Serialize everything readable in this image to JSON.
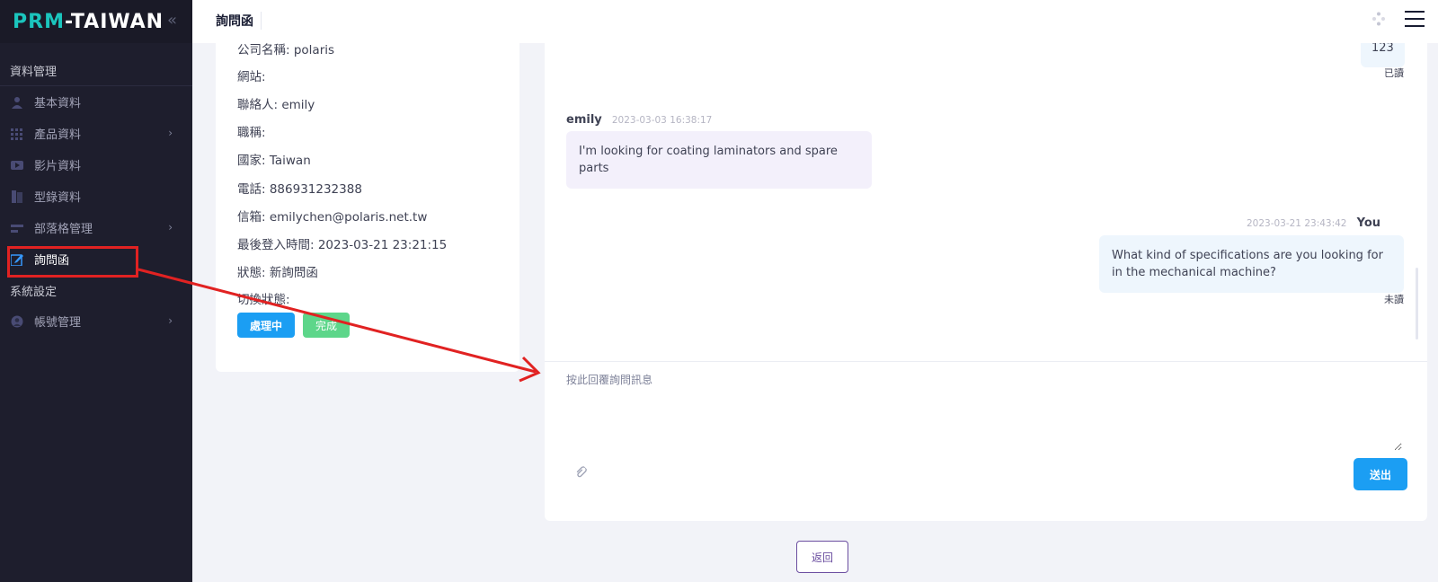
{
  "brand": {
    "logo_part1": "PRM",
    "logo_part2": "-TAIWAN",
    "toggle": "«"
  },
  "sidebar": {
    "section_data": "資料管理",
    "items": [
      {
        "label": "基本資料",
        "icon": "user-icon",
        "has_arrow": false
      },
      {
        "label": "產品資料",
        "icon": "grid-icon",
        "has_arrow": true
      },
      {
        "label": "影片資料",
        "icon": "video-icon",
        "has_arrow": false
      },
      {
        "label": "型錄資料",
        "icon": "book-icon",
        "has_arrow": false
      },
      {
        "label": "部落格管理",
        "icon": "blog-icon",
        "has_arrow": true
      },
      {
        "label": "詢問函",
        "icon": "edit-icon",
        "has_arrow": false,
        "active": true
      }
    ],
    "section_system": "系統設定",
    "system_items": [
      {
        "label": "帳號管理",
        "icon": "account-icon",
        "has_arrow": true
      }
    ],
    "arrow_glyph": "›"
  },
  "header": {
    "title": "詢問函"
  },
  "info": {
    "company": "公司名稱: polaris",
    "website": "網站:",
    "contact": "聯絡人: emily",
    "job_title": "職稱:",
    "country": "國家: Taiwan",
    "phone": "電話: 886931232388",
    "email": "信箱: emilychen@polaris.net.tw",
    "last_login": "最後登入時間: 2023-03-21 23:21:15",
    "status": "狀態: 新詢問函",
    "switch_status": "切換狀態:",
    "btn_processing": "處理中",
    "btn_done": "完成"
  },
  "chat": {
    "first_out_text": "123",
    "first_out_read": "已讀",
    "msg1": {
      "name": "emily",
      "time": "2023-03-03 16:38:17",
      "text": "I'm looking for coating laminators and spare parts"
    },
    "msg2": {
      "name": "You",
      "time": "2023-03-21 23:43:42",
      "text": "What kind of specifications are you looking for in the mechanical machine?",
      "read": "未讀"
    },
    "reply_placeholder": "按此回覆詢問訊息",
    "send_label": "送出",
    "attach_icon": "paperclip-icon"
  },
  "back_label": "返回",
  "colors": {
    "sidebar_bg": "#1e1e2d",
    "primary": "#1b9ef3",
    "success": "#5dd68a",
    "annotation": "#e12222",
    "back_border": "#6b4ea0"
  }
}
